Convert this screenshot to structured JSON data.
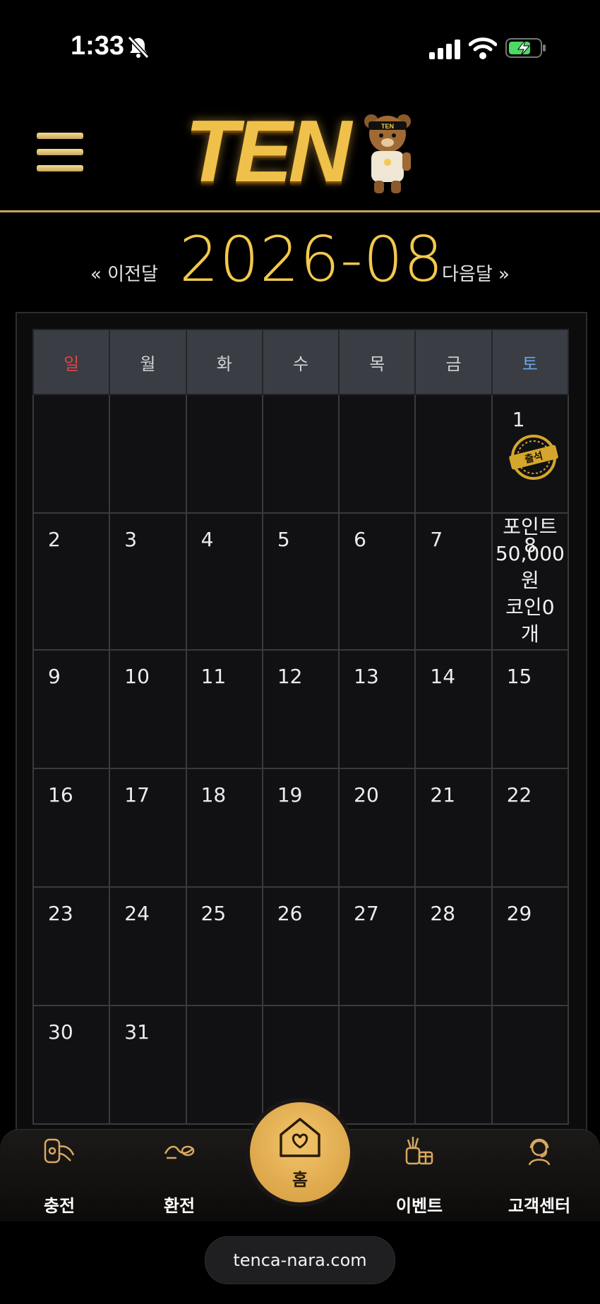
{
  "status_bar": {
    "time": "1:33"
  },
  "header": {
    "logo_text": "TEN",
    "bear_badge": "TEN"
  },
  "month_nav": {
    "prev_label": "« 이전달",
    "title": "2026-08",
    "next_label": "다음달 »"
  },
  "calendar": {
    "weekdays": [
      "일",
      "월",
      "화",
      "수",
      "목",
      "금",
      "토"
    ],
    "weeks": [
      [
        "",
        "",
        "",
        "",
        "",
        "",
        "1"
      ],
      [
        "2",
        "3",
        "4",
        "5",
        "6",
        "7",
        "8"
      ],
      [
        "9",
        "10",
        "11",
        "12",
        "13",
        "14",
        "15"
      ],
      [
        "16",
        "17",
        "18",
        "19",
        "20",
        "21",
        "22"
      ],
      [
        "23",
        "24",
        "25",
        "26",
        "27",
        "28",
        "29"
      ],
      [
        "30",
        "31",
        "",
        "",
        "",
        "",
        ""
      ]
    ],
    "stamp_label": "출석",
    "reward_lines": [
      "포인트",
      "50,000",
      "원",
      "코인0",
      "개"
    ]
  },
  "bottom_nav": {
    "items": [
      {
        "label": "충전",
        "icon": "charge-icon"
      },
      {
        "label": "환전",
        "icon": "exchange-icon"
      },
      {
        "label": "홈",
        "icon": "home-icon"
      },
      {
        "label": "이벤트",
        "icon": "gift-icon"
      },
      {
        "label": "고객센터",
        "icon": "support-icon"
      }
    ]
  },
  "browser": {
    "url": "tenca-nara.com"
  },
  "colors": {
    "gold": "#f2c94c",
    "sunday": "#e04444",
    "saturday": "#6ca7e8",
    "accent_line": "#c9a55a"
  }
}
